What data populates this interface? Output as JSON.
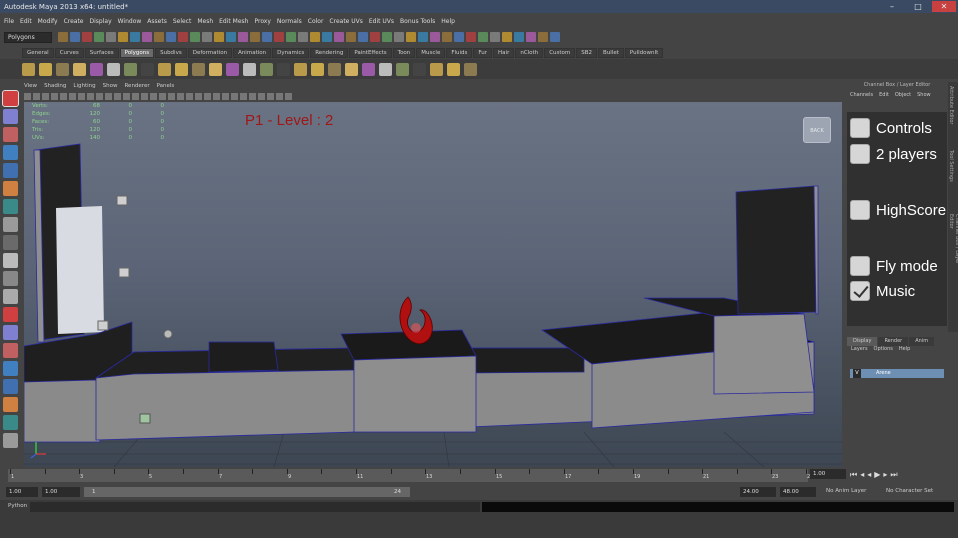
{
  "window": {
    "title": "Autodesk Maya 2013 x64: untitled*"
  },
  "menubar": [
    "File",
    "Edit",
    "Modify",
    "Create",
    "Display",
    "Window",
    "Assets",
    "Select",
    "Mesh",
    "Edit Mesh",
    "Proxy",
    "Normals",
    "Color",
    "Create UVs",
    "Edit UVs",
    "Bonus Tools",
    "Help"
  ],
  "statusline": {
    "menuset": "Polygons"
  },
  "shelf_tabs": [
    "General",
    "Curves",
    "Surfaces",
    "Polygons",
    "Subdivs",
    "Deformation",
    "Animation",
    "Dynamics",
    "Rendering",
    "PaintEffects",
    "Toon",
    "Muscle",
    "Fluids",
    "Fur",
    "Hair",
    "nCloth",
    "Custom",
    "SB2",
    "Bullet",
    "PulldownIt"
  ],
  "shelf_active": "Polygons",
  "viewport_menu": [
    "View",
    "Shading",
    "Lighting",
    "Show",
    "Renderer",
    "Panels"
  ],
  "hud": [
    {
      "label": "Verts:",
      "a": "68",
      "b": "0",
      "c": "0"
    },
    {
      "label": "Edges:",
      "a": "120",
      "b": "0",
      "c": "0"
    },
    {
      "label": "Faces:",
      "a": "60",
      "b": "0",
      "c": "0"
    },
    {
      "label": "Tris:",
      "a": "120",
      "b": "0",
      "c": "0"
    },
    {
      "label": "UVs:",
      "a": "140",
      "b": "0",
      "c": "0"
    }
  ],
  "level_text": "P1 - Level : 2",
  "back_label": "BACK",
  "channel_box": {
    "header": "Channel Box / Layer Editor",
    "tabs": [
      "Channels",
      "Edit",
      "Object",
      "Show"
    ]
  },
  "game_menu": {
    "options": [
      {
        "label": "Controls",
        "checked": false
      },
      {
        "label": "2 players",
        "checked": false
      },
      {
        "label": "HighScore",
        "checked": false
      },
      {
        "label": "Fly mode",
        "checked": false
      },
      {
        "label": "Music",
        "checked": true
      }
    ]
  },
  "side_tabs": [
    "Attribute Editor",
    "Tool Settings",
    "Channel Box / Layer Editor"
  ],
  "layer_editor": {
    "tabs": [
      "Display",
      "Render",
      "Anim"
    ],
    "menu": [
      "Layers",
      "Options",
      "Help"
    ],
    "layer_visibility": "V",
    "layer_name": "Arene"
  },
  "timeline": {
    "ticks": [
      "1",
      "2",
      "3",
      "4",
      "5",
      "6",
      "7",
      "8",
      "9",
      "10",
      "11",
      "12",
      "13",
      "14",
      "15",
      "16",
      "17",
      "18",
      "19",
      "20",
      "21",
      "22",
      "23",
      "24"
    ],
    "current": "1.00"
  },
  "range": {
    "start": "1.00",
    "playback_start": "1.00",
    "range_start": "1",
    "range_end": "24",
    "playback_end": "24.00",
    "end": "48.00",
    "anim_layer": "No Anim Layer",
    "character_set": "No Character Set"
  },
  "cmdline": {
    "label": "Python"
  },
  "colors": {
    "title_bg": "#3a4a63",
    "level_text": "#a01717",
    "highlight": "#6d8fb3"
  }
}
